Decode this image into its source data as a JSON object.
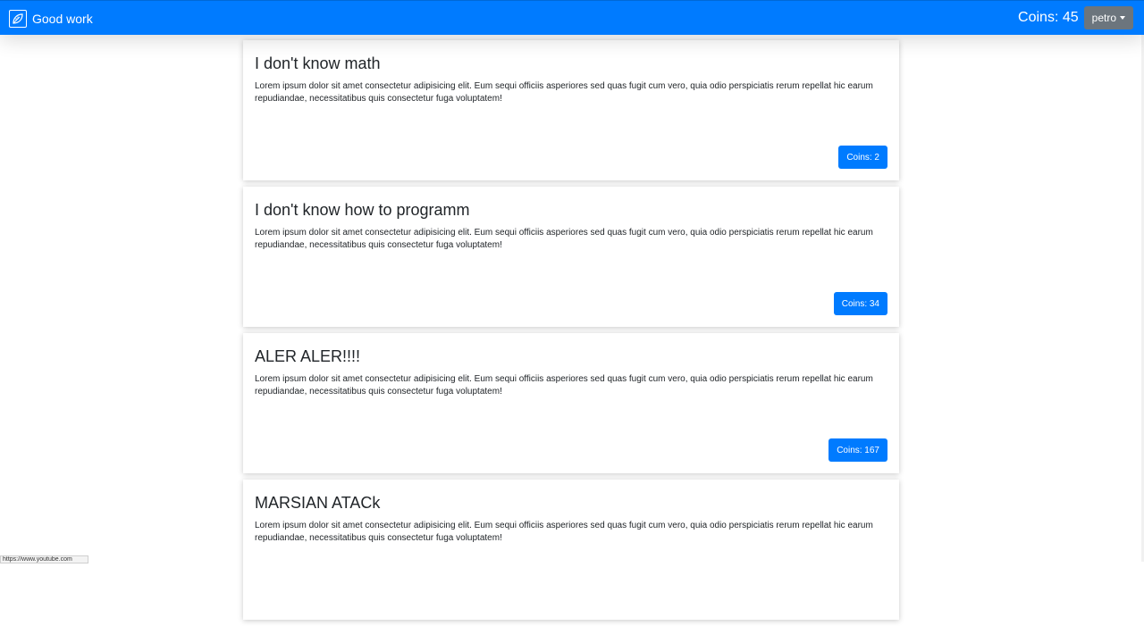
{
  "navbar": {
    "brand": "Good work",
    "brand_icon": "leaf-logo-icon",
    "coins": "Coins: 45",
    "user": "petro",
    "accent": "#007bff"
  },
  "cards": [
    {
      "title": "I don't know math",
      "text": "Lorem ipsum dolor sit amet consectetur adipisicing elit. Eum sequi officiis asperiores sed quas fugit cum vero, quia odio perspiciatis rerum repellat hic earum repudiandae, necessitatibus quis consectetur fuga voluptatem!",
      "coins": "Coins: 2"
    },
    {
      "title": "I don't know how to programm",
      "text": "Lorem ipsum dolor sit amet consectetur adipisicing elit. Eum sequi officiis asperiores sed quas fugit cum vero, quia odio perspiciatis rerum repellat hic earum repudiandae, necessitatibus quis consectetur fuga voluptatem!",
      "coins": "Coins: 34"
    },
    {
      "title": "ALER ALER!!!!",
      "text": "Lorem ipsum dolor sit amet consectetur adipisicing elit. Eum sequi officiis asperiores sed quas fugit cum vero, quia odio perspiciatis rerum repellat hic earum repudiandae, necessitatibus quis consectetur fuga voluptatem!",
      "coins": "Coins: 167"
    },
    {
      "title": "MARSIAN ATACk",
      "text": "Lorem ipsum dolor sit amet consectetur adipisicing elit. Eum sequi officiis asperiores sed quas fugit cum vero, quia odio perspiciatis rerum repellat hic earum repudiandae, necessitatibus quis consectetur fuga voluptatem!",
      "coins": ""
    }
  ],
  "status_bar": {
    "url": "https://www.youtube.com"
  }
}
